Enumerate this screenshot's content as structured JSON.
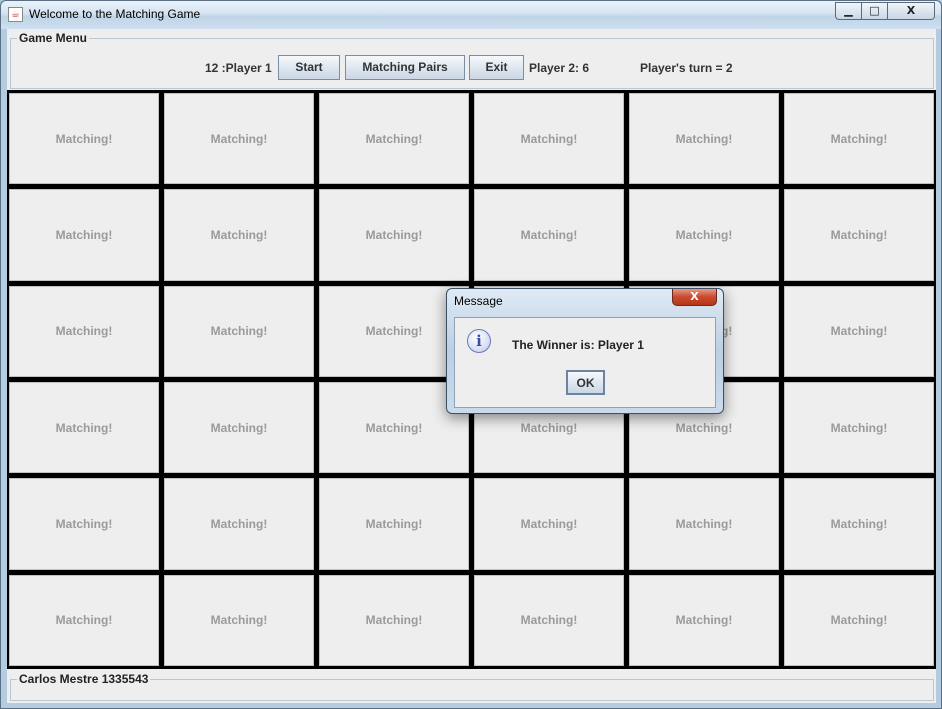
{
  "window": {
    "title": "Welcome to the Matching Game",
    "minimize_glyph": "▁",
    "maximize_glyph": "□",
    "close_glyph": "X",
    "app_icon": "java-icon"
  },
  "menu": {
    "legend": "Game Menu",
    "player1_label": "12 :Player 1",
    "start_button": "Start",
    "matching_pairs_button": "Matching Pairs",
    "exit_button": "Exit",
    "player2_label": "Player 2:  6",
    "turn_label": "Player's turn =   2"
  },
  "grid": {
    "rows": 6,
    "cols": 6,
    "card_text": "Matching!"
  },
  "footer": {
    "legend": "Carlos Mestre 1335543"
  },
  "dialog": {
    "title": "Message",
    "icon": "info-icon",
    "message": "The Winner is:  Player 1",
    "ok_button": "OK",
    "close_glyph": "X"
  }
}
